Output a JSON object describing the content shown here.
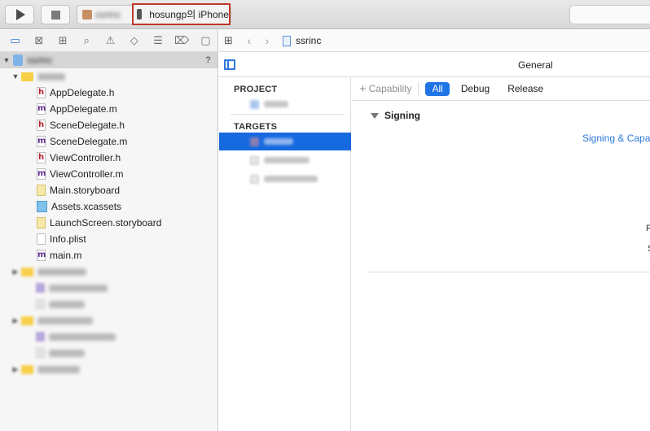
{
  "toolbar": {
    "scheme_target": "ssrinc",
    "device_name": "hosungp의 iPhone"
  },
  "navigator": {
    "tabs": [
      {
        "name": "project-navigator-icon",
        "glyph": "▭",
        "active": true
      },
      {
        "name": "source-control-icon",
        "glyph": "⊠"
      },
      {
        "name": "symbol-navigator-icon",
        "glyph": "⊞"
      },
      {
        "name": "find-navigator-icon",
        "glyph": "⌕"
      },
      {
        "name": "issue-navigator-icon",
        "glyph": "⚠"
      },
      {
        "name": "test-navigator-icon",
        "glyph": "◇"
      },
      {
        "name": "debug-navigator-icon",
        "glyph": "☰"
      },
      {
        "name": "breakpoint-navigator-icon",
        "glyph": "⌦"
      },
      {
        "name": "report-navigator-icon",
        "glyph": "▢"
      }
    ],
    "project_row": {
      "label": "ssrinc",
      "badge": "?"
    },
    "files": [
      {
        "label": "AppDelegate.h",
        "kind": "h"
      },
      {
        "label": "AppDelegate.m",
        "kind": "m"
      },
      {
        "label": "SceneDelegate.h",
        "kind": "h"
      },
      {
        "label": "SceneDelegate.m",
        "kind": "m"
      },
      {
        "label": "ViewController.h",
        "kind": "h"
      },
      {
        "label": "ViewController.m",
        "kind": "m"
      },
      {
        "label": "Main.storyboard",
        "kind": "sb"
      },
      {
        "label": "Assets.xcassets",
        "kind": "xc"
      },
      {
        "label": "LaunchScreen.storyboard",
        "kind": "sb"
      },
      {
        "label": "Info.plist",
        "kind": "pl"
      },
      {
        "label": "main.m",
        "kind": "m"
      }
    ]
  },
  "editor": {
    "jump_title": "ssrinc",
    "tabs": {
      "general": "General",
      "signing": "Signing & Capab"
    },
    "project_header": "PROJECT",
    "targets_header": "TARGETS",
    "capability_label": "Capability",
    "segments": {
      "all": "All",
      "debug": "Debug",
      "release": "Release"
    },
    "signing_title": "Signing",
    "cut_letters": {
      "a": "P",
      "b": "S"
    }
  }
}
